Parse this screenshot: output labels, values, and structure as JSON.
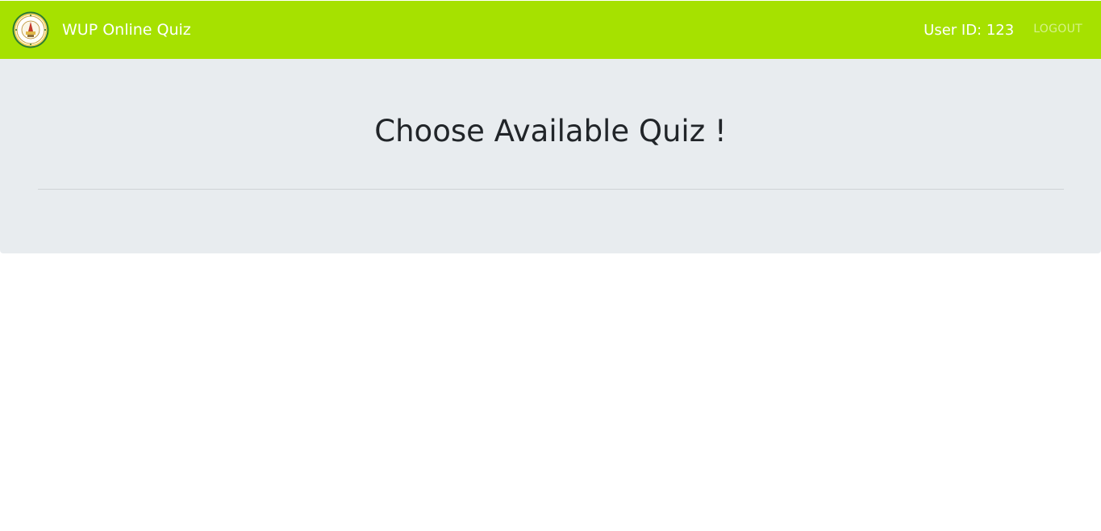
{
  "navbar": {
    "brand_text": "WUP Online Quiz",
    "logo_icon": "university-seal-icon",
    "user_id_text": "User ID: 123",
    "logout_label": "LOGOUT",
    "background_color": "#a6e100"
  },
  "main": {
    "title": "Choose Available Quiz !",
    "background_color": "#e8ecef"
  }
}
